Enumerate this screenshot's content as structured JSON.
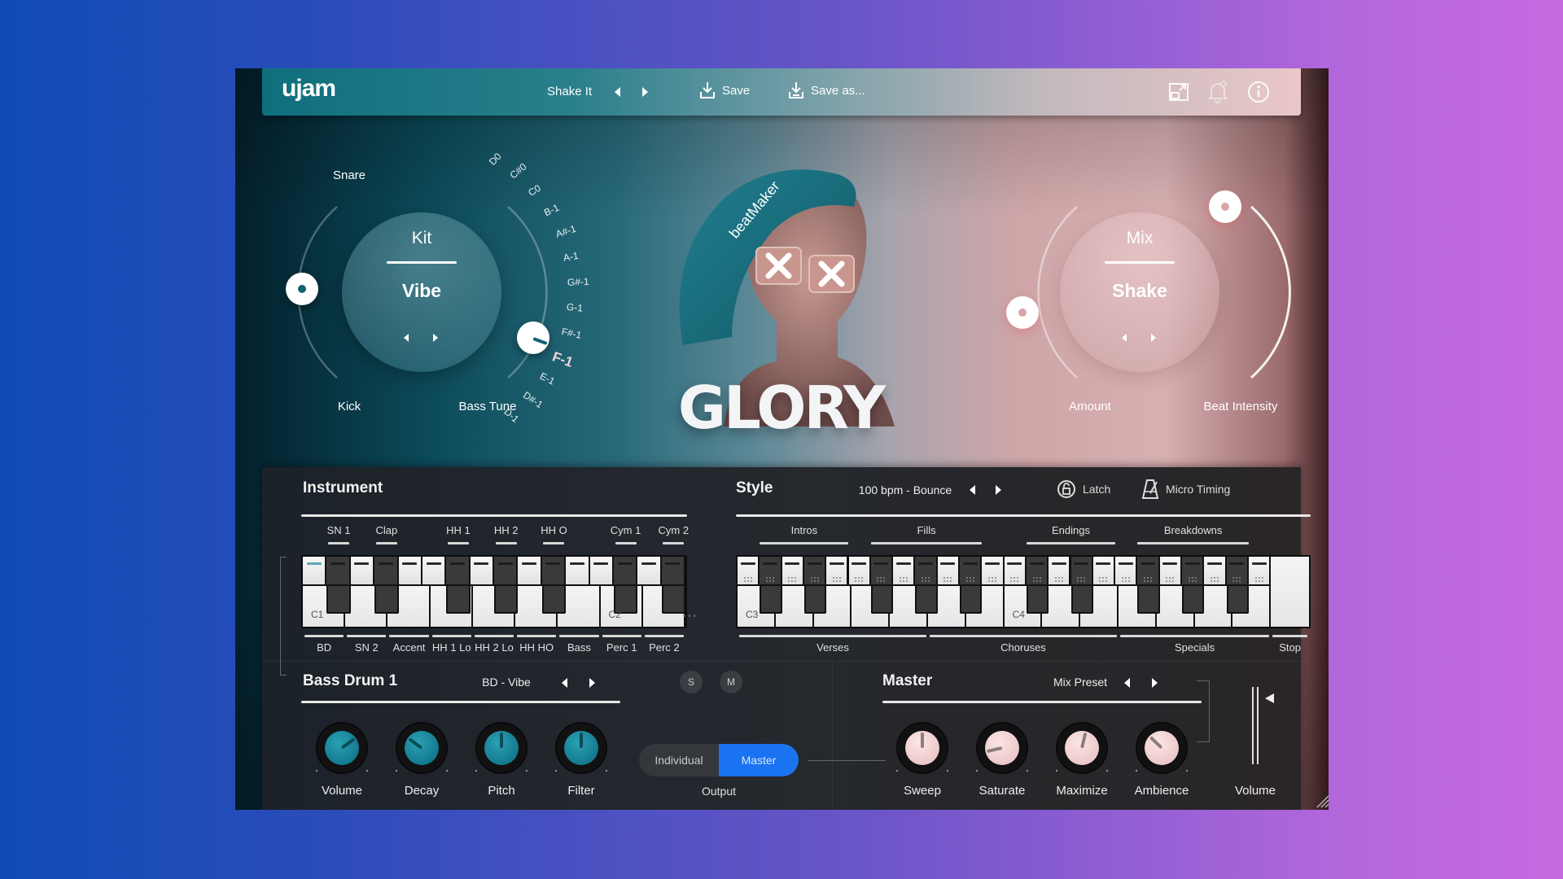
{
  "header": {
    "logo": "ujam",
    "preset_name": "Shake It",
    "save_label": "Save",
    "save_as_label": "Save as...",
    "icons": [
      "resize-icon",
      "bell-icon",
      "info-icon"
    ]
  },
  "kit": {
    "title": "Kit",
    "value": "Vibe",
    "snare_label": "Snare",
    "kick_label": "Kick",
    "bass_tune_label": "Bass Tune",
    "bass_tune_value": "F-1",
    "bass_tune_notes": [
      "D0",
      "C#0",
      "C0",
      "B-1",
      "A#-1",
      "A-1",
      "G#-1",
      "G-1",
      "F#-1",
      "F-1",
      "E-1",
      "D#-1",
      "D-1"
    ],
    "snare_kick_balance": 0.5
  },
  "artwork": {
    "product_name": "GLORY",
    "cap_text": "beatMaker"
  },
  "mix": {
    "title": "Mix",
    "value": "Shake",
    "amount_label": "Amount",
    "beat_intensity_label": "Beat Intensity",
    "amount_value": 0.35,
    "beat_intensity_value": 0.95
  },
  "instrument": {
    "title": "Instrument",
    "top_labels": [
      "SN 1",
      "Clap",
      "HH 1",
      "HH 2",
      "HH O",
      "Cym 1",
      "Cym 2"
    ],
    "bottom_labels": [
      "BD",
      "SN 2",
      "Accent",
      "HH 1 Lo",
      "HH 2 Lo",
      "HH HO",
      "Bass",
      "Perc 1",
      "Perc 2"
    ],
    "octave_labels": [
      "C1",
      "C2"
    ],
    "more_indicator": "• • •"
  },
  "style": {
    "title": "Style",
    "preset": "100 bpm - Bounce",
    "latch_label": "Latch",
    "micro_timing_label": "Micro Timing",
    "top_groups": [
      "Intros",
      "Fills",
      "Endings",
      "Breakdowns"
    ],
    "bottom_groups": [
      "Verses",
      "Choruses",
      "Specials",
      "Stop"
    ],
    "octave_labels": [
      "C3",
      "C4"
    ]
  },
  "instrument_detail": {
    "title": "Bass Drum 1",
    "preset": "BD - Vibe",
    "solo_label": "S",
    "mute_label": "M",
    "knobs": [
      {
        "label": "Volume",
        "value": 0.7
      },
      {
        "label": "Decay",
        "value": 0.3
      },
      {
        "label": "Pitch",
        "value": 0.5
      },
      {
        "label": "Filter",
        "value": 0.5
      }
    ]
  },
  "output": {
    "label": "Output",
    "options": [
      "Individual",
      "Master"
    ],
    "selected": "Master"
  },
  "master": {
    "title": "Master",
    "preset_label": "Mix Preset",
    "knobs": [
      {
        "label": "Sweep",
        "value": 0.5
      },
      {
        "label": "Saturate",
        "value": 0.12
      },
      {
        "label": "Maximize",
        "value": 0.55
      },
      {
        "label": "Ambience",
        "value": 0.33
      }
    ],
    "volume_label": "Volume",
    "volume_value": 0.85
  },
  "colors": {
    "accent_blue": "#1a73f0",
    "knob_teal": "#1a8ca0",
    "knob_pink": "#f2d0d1"
  }
}
